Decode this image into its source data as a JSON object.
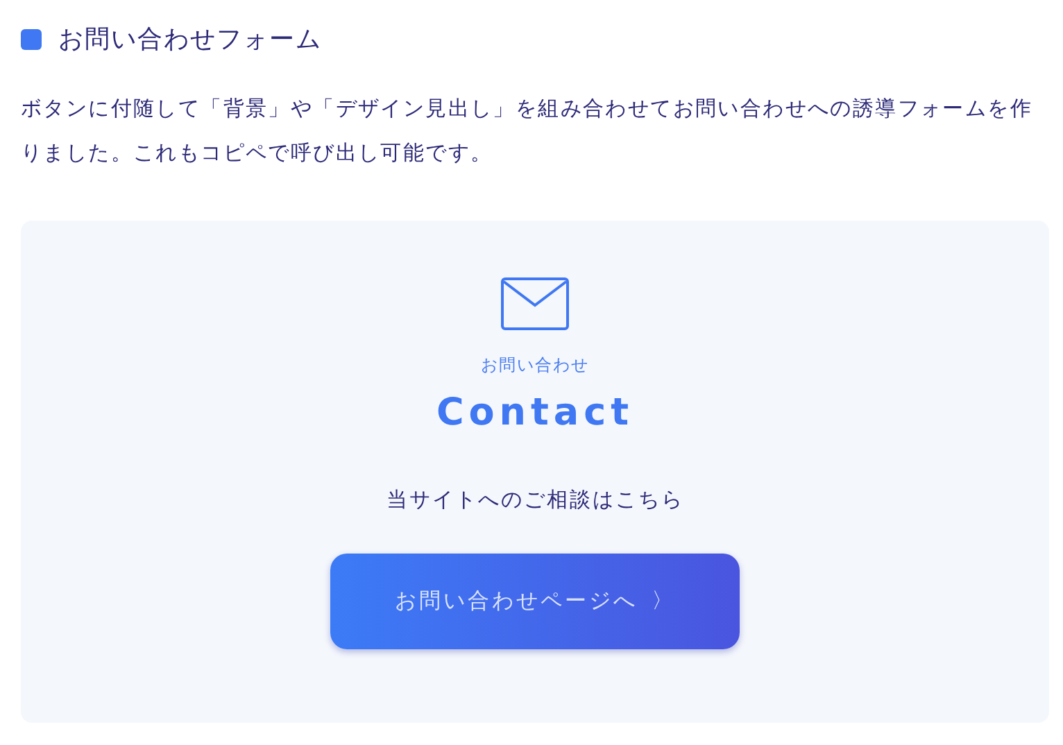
{
  "heading": {
    "title": "お問い合わせフォーム"
  },
  "description": "ボタンに付随して「背景」や「デザイン見出し」を組み合わせてお問い合わせへの誘導フォームを作りました。これもコピペで呼び出し可能です。",
  "contact_card": {
    "label": "お問い合わせ",
    "title": "Contact",
    "message": "当サイトへのご相談はこちら",
    "button": {
      "label": "お問い合わせページへ",
      "arrow": "〉"
    }
  }
}
